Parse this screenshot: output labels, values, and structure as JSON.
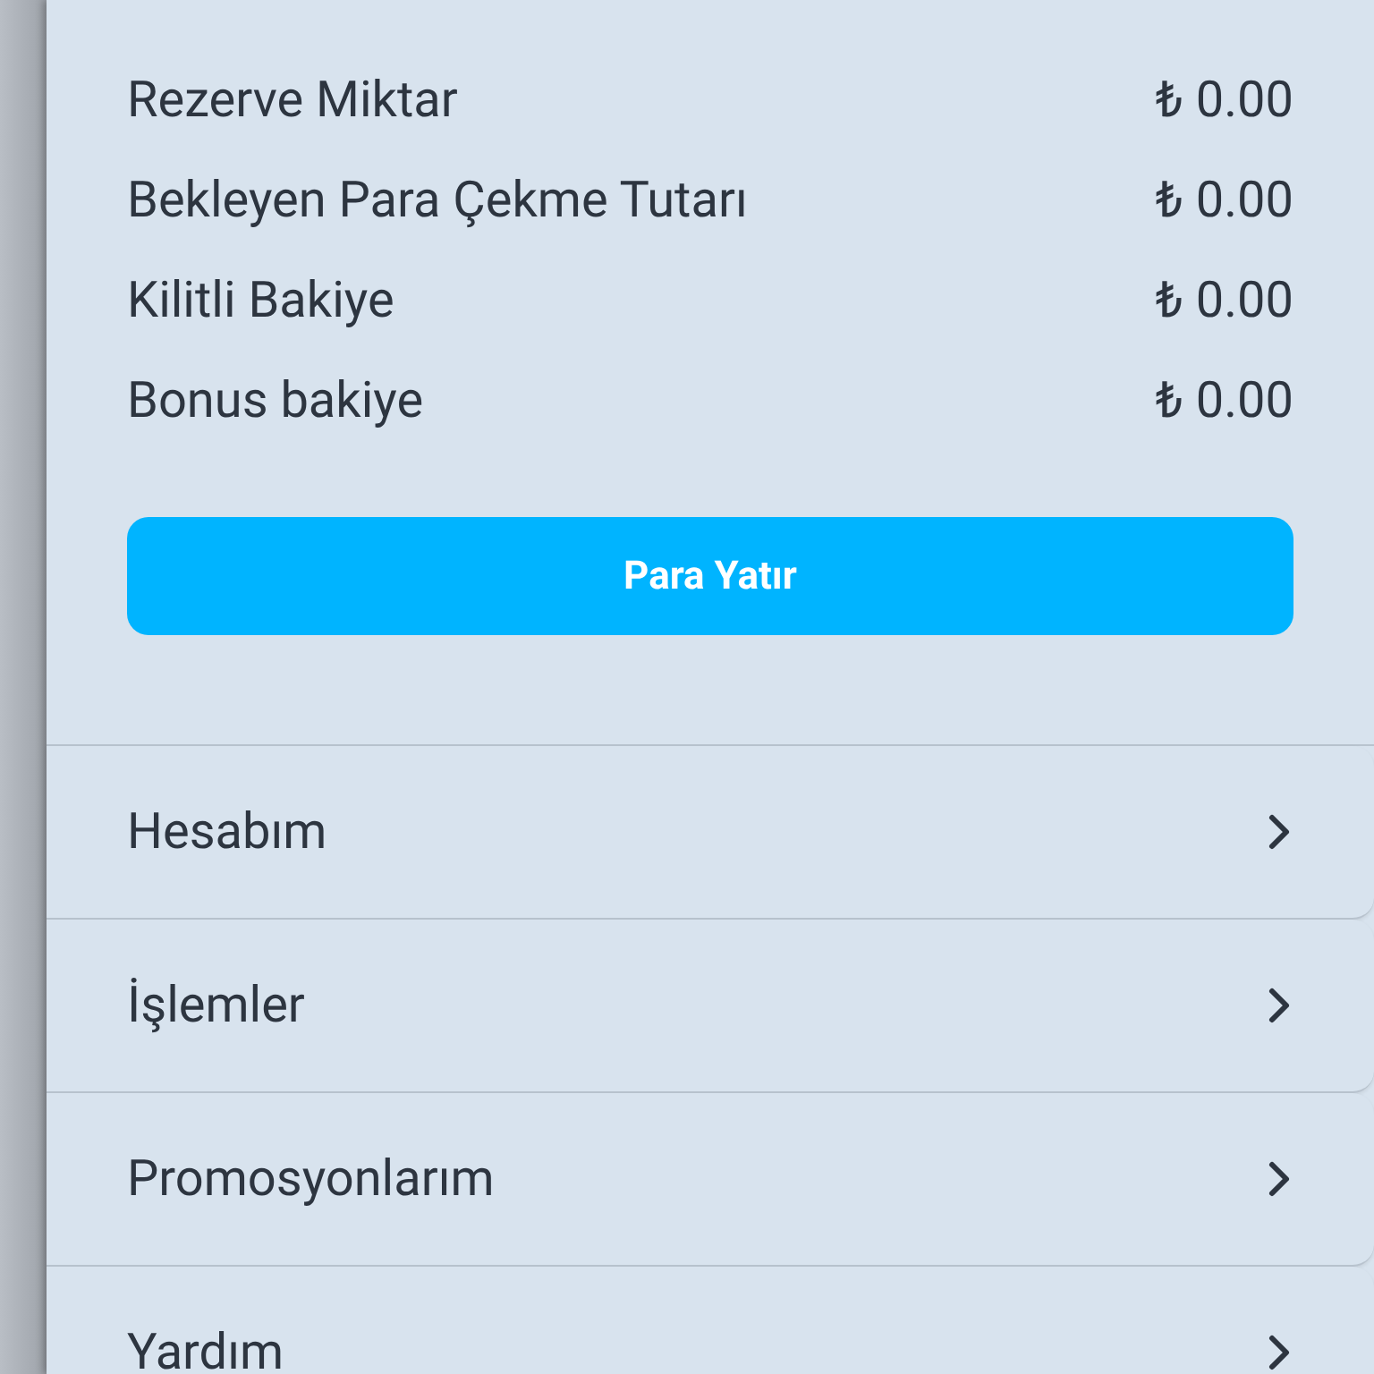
{
  "balances": [
    {
      "label": "Rezerve Miktar",
      "value": "₺ 0.00"
    },
    {
      "label": "Bekleyen Para Çekme Tutarı",
      "value": "₺ 0.00"
    },
    {
      "label": "Kilitli Bakiye",
      "value": "₺ 0.00"
    },
    {
      "label": "Bonus bakiye",
      "value": "₺ 0.00"
    }
  ],
  "deposit_button": "Para Yatır",
  "menu": [
    {
      "label": "Hesabım"
    },
    {
      "label": "İşlemler"
    },
    {
      "label": "Promosyonlarım"
    },
    {
      "label": "Yardım"
    }
  ]
}
